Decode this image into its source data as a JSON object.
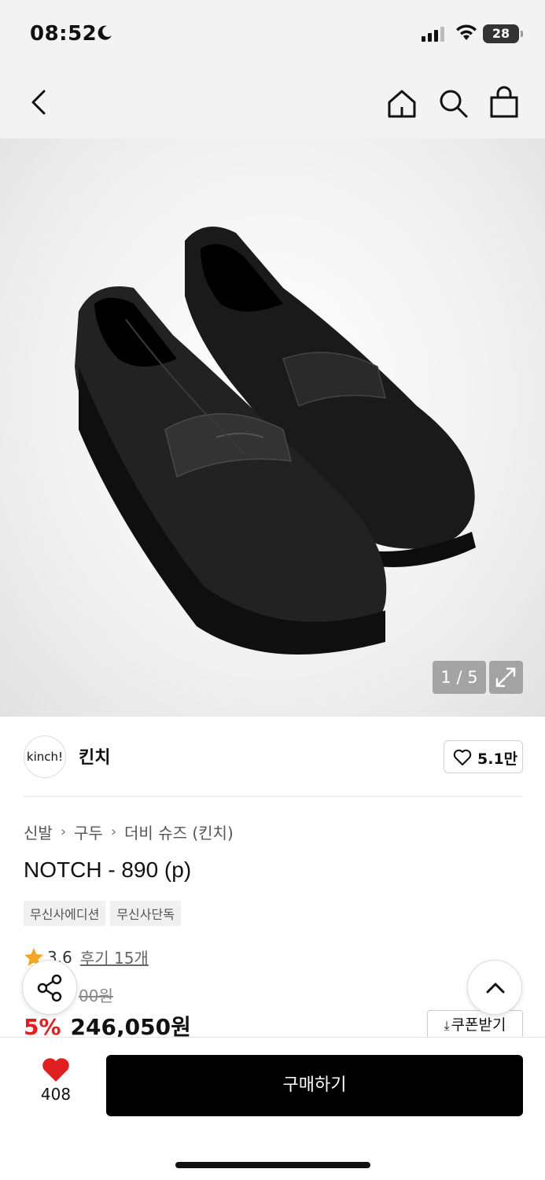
{
  "status_bar": {
    "time": "08:52",
    "battery": "28"
  },
  "header": {
    "icons": [
      "back-icon",
      "home-icon",
      "search-icon",
      "shopping-bag-icon"
    ]
  },
  "gallery": {
    "counter": "1 / 5"
  },
  "brand": {
    "logo_text": "kinch!",
    "name": "킨치",
    "likes": "5.1만"
  },
  "breadcrumb": [
    "신발",
    "구두",
    "더비 슈즈 (킨치)"
  ],
  "product": {
    "title": "NOTCH - 890 (p)",
    "tags": [
      "무신사에디션",
      "무신사단독"
    ],
    "rating": "3.6",
    "review_link": "후기 15개",
    "original_price": "00원",
    "discount": "5%",
    "price": "246,050원",
    "coupon_label": "쿠폰받기"
  },
  "bottom_bar": {
    "wish_count": "408",
    "buy_label": "구매하기"
  },
  "colors": {
    "accent_red": "#e02020",
    "star": "#f5a623",
    "buy_bg": "#000000"
  }
}
